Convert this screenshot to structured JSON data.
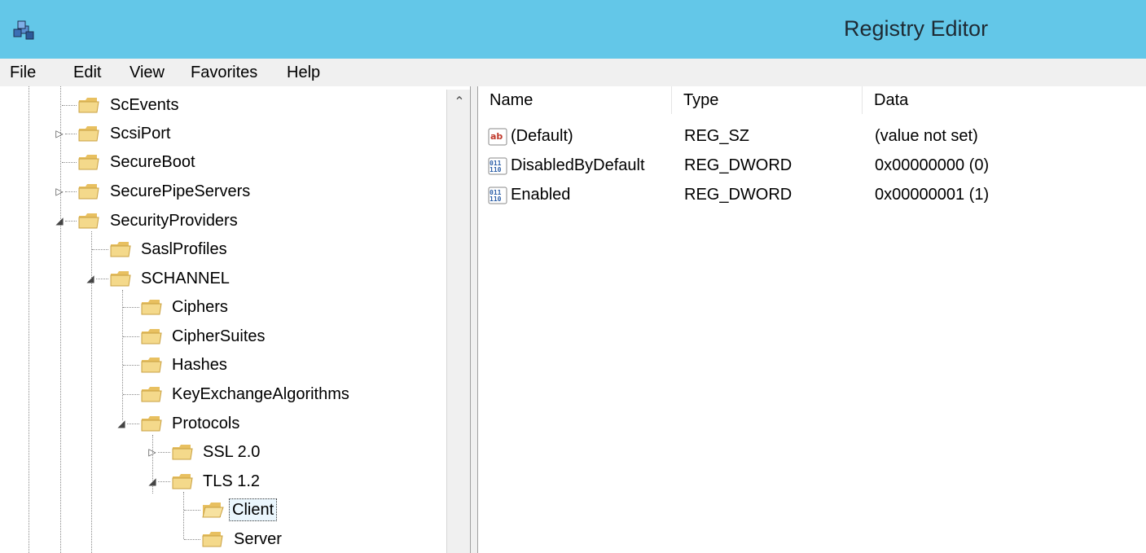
{
  "window": {
    "title": "Registry Editor",
    "icon": "registry-editor-icon",
    "titlebar_color": "#63c7e8"
  },
  "menu": {
    "file": "File",
    "edit": "Edit",
    "view": "View",
    "favorites": "Favorites",
    "help": "Help"
  },
  "tree": {
    "nodes": [
      {
        "label": "ScEvents",
        "expander": "none",
        "selected": false
      },
      {
        "label": "ScsiPort",
        "expander": "collapsed",
        "selected": false
      },
      {
        "label": "SecureBoot",
        "expander": "none",
        "selected": false
      },
      {
        "label": "SecurePipeServers",
        "expander": "collapsed",
        "selected": false
      },
      {
        "label": "SecurityProviders",
        "expander": "expanded",
        "selected": false
      },
      {
        "label": "SaslProfiles",
        "expander": "none",
        "selected": false
      },
      {
        "label": "SCHANNEL",
        "expander": "expanded",
        "selected": false
      },
      {
        "label": "Ciphers",
        "expander": "none",
        "selected": false
      },
      {
        "label": "CipherSuites",
        "expander": "none",
        "selected": false
      },
      {
        "label": "Hashes",
        "expander": "none",
        "selected": false
      },
      {
        "label": "KeyExchangeAlgorithms",
        "expander": "none",
        "selected": false
      },
      {
        "label": "Protocols",
        "expander": "expanded",
        "selected": false
      },
      {
        "label": "SSL 2.0",
        "expander": "collapsed",
        "selected": false
      },
      {
        "label": "TLS 1.2",
        "expander": "expanded",
        "selected": false
      },
      {
        "label": "Client",
        "expander": "none",
        "selected": true
      },
      {
        "label": "Server",
        "expander": "none",
        "selected": false
      }
    ]
  },
  "values": {
    "columns": {
      "name": "Name",
      "type": "Type",
      "data": "Data"
    },
    "rows": [
      {
        "icon": "string-value-icon",
        "name": "(Default)",
        "type": "REG_SZ",
        "data": "(value not set)"
      },
      {
        "icon": "binary-value-icon",
        "name": "DisabledByDefault",
        "type": "REG_DWORD",
        "data": "0x00000000 (0)"
      },
      {
        "icon": "binary-value-icon",
        "name": "Enabled",
        "type": "REG_DWORD",
        "data": "0x00000001 (1)"
      }
    ]
  }
}
